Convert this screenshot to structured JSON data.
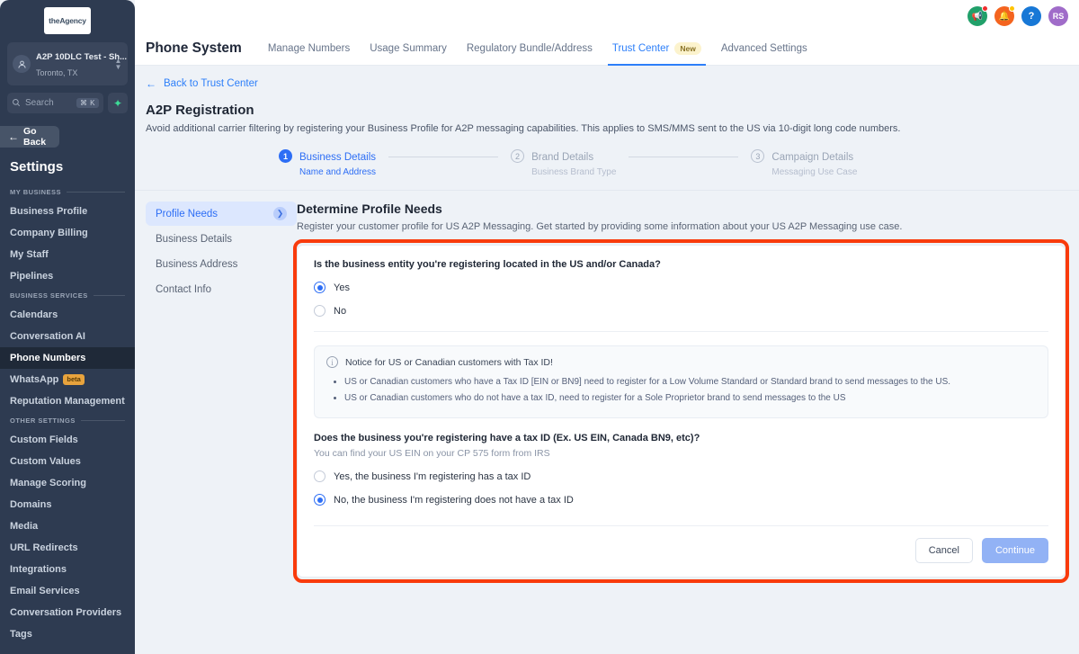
{
  "sidebar": {
    "logo_text": "theAgency",
    "location": {
      "name": "A2P 10DLC Test - Sh...",
      "sub": "Toronto, TX",
      "avatar_icon": "user-circle-icon",
      "caret_icon": "chevron-updown-icon"
    },
    "search": {
      "placeholder": "Search",
      "shortcut": "⌘ K",
      "icon": "search-icon",
      "spark_icon": "sparkle-icon"
    },
    "go_back": "Go Back",
    "go_back_icon": "arrow-left-icon",
    "title": "Settings",
    "sections": [
      {
        "label": "MY BUSINESS",
        "items": [
          {
            "label": "Business Profile",
            "active": false
          },
          {
            "label": "Company Billing",
            "active": false
          },
          {
            "label": "My Staff",
            "active": false
          },
          {
            "label": "Pipelines",
            "active": false
          }
        ]
      },
      {
        "label": "BUSINESS SERVICES",
        "items": [
          {
            "label": "Calendars",
            "active": false
          },
          {
            "label": "Conversation AI",
            "active": false
          },
          {
            "label": "Phone Numbers",
            "active": true
          },
          {
            "label": "WhatsApp",
            "active": false,
            "badge": "beta"
          },
          {
            "label": "Reputation Management",
            "active": false
          }
        ]
      },
      {
        "label": "OTHER SETTINGS",
        "items": [
          {
            "label": "Custom Fields",
            "active": false
          },
          {
            "label": "Custom Values",
            "active": false
          },
          {
            "label": "Manage Scoring",
            "active": false
          },
          {
            "label": "Domains",
            "active": false
          },
          {
            "label": "Media",
            "active": false
          },
          {
            "label": "URL Redirects",
            "active": false
          },
          {
            "label": "Integrations",
            "active": false
          },
          {
            "label": "Email Services",
            "active": false
          },
          {
            "label": "Conversation Providers",
            "active": false
          },
          {
            "label": "Tags",
            "active": false
          }
        ]
      }
    ]
  },
  "topbar": {
    "icons": [
      {
        "name": "megaphone-icon",
        "glyph": "📢",
        "color": "#21a06a",
        "dot": "red"
      },
      {
        "name": "bell-icon",
        "glyph": "🔔",
        "color": "#f4641f",
        "dot": "yellow"
      },
      {
        "name": "help-icon",
        "glyph": "?",
        "color": "#1878d6",
        "dot": "none"
      },
      {
        "name": "avatar",
        "glyph": "RS",
        "color": "#a06cc9",
        "dot": "none"
      }
    ]
  },
  "tabbar": {
    "title": "Phone System",
    "tabs": [
      {
        "label": "Manage Numbers",
        "active": false
      },
      {
        "label": "Usage Summary",
        "active": false
      },
      {
        "label": "Regulatory Bundle/Address",
        "active": false
      },
      {
        "label": "Trust Center",
        "active": true,
        "badge": "New"
      },
      {
        "label": "Advanced Settings",
        "active": false
      }
    ]
  },
  "page": {
    "back_link": "Back to Trust Center",
    "back_icon": "arrow-left-icon",
    "heading": "A2P Registration",
    "subheading": "Avoid additional carrier filtering by registering your Business Profile for A2P messaging capabilities. This applies to SMS/MMS sent to the US via 10-digit long code numbers."
  },
  "stepper": [
    {
      "num": "1",
      "label": "Business Details",
      "sub": "Name and Address",
      "state": "done"
    },
    {
      "num": "2",
      "label": "Brand Details",
      "sub": "Business Brand Type",
      "state": "todo"
    },
    {
      "num": "3",
      "label": "Campaign Details",
      "sub": "Messaging Use Case",
      "state": "todo"
    }
  ],
  "left_nav": [
    {
      "label": "Profile Needs",
      "active": true,
      "chevron_icon": "chevron-right-icon"
    },
    {
      "label": "Business Details",
      "active": false
    },
    {
      "label": "Business Address",
      "active": false
    },
    {
      "label": "Contact Info",
      "active": false
    }
  ],
  "form": {
    "title": "Determine Profile Needs",
    "subtitle": "Register your customer profile for US A2P Messaging. Get started by providing some information about your US A2P Messaging use case.",
    "question1": {
      "label": "Is the business entity you're registering located in the US and/or Canada?",
      "options": [
        {
          "label": "Yes",
          "selected": true
        },
        {
          "label": "No",
          "selected": false
        }
      ]
    },
    "notice": {
      "icon": "info-icon",
      "title": "Notice for US or Canadian customers with Tax ID!",
      "bullets": [
        "US or Canadian customers who have a Tax ID [EIN or BN9] need to register for a Low Volume Standard or Standard brand to send messages to the US.",
        "US or Canadian customers who do not have a tax ID, need to register for a Sole Proprietor brand to send messages to the US"
      ]
    },
    "question2": {
      "label": "Does the business you're registering have a tax ID (Ex. US EIN, Canada BN9, etc)?",
      "hint": "You can find your US EIN on your CP 575 form from IRS",
      "options": [
        {
          "label": "Yes, the business I'm registering has a tax ID",
          "selected": false
        },
        {
          "label": "No, the business I'm registering does not have a tax ID",
          "selected": true
        }
      ]
    },
    "cancel_label": "Cancel",
    "continue_label": "Continue"
  },
  "highlight": {
    "color": "#f93b0c"
  }
}
